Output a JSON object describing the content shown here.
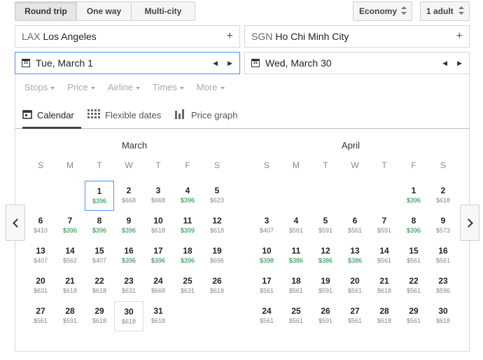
{
  "trip_type": {
    "options": [
      "Round trip",
      "One way",
      "Multi-city"
    ],
    "selected": "Round trip"
  },
  "cabin": {
    "value": "Economy"
  },
  "passengers": {
    "value": "1 adult"
  },
  "origin": {
    "code": "LAX",
    "city": "Los Angeles",
    "add": "+"
  },
  "destination": {
    "code": "SGN",
    "city": "Ho Chi Minh City",
    "add": "+"
  },
  "depart_date": {
    "value": "Tue, March 1",
    "icon_text": "31"
  },
  "return_date": {
    "value": "Wed, March 30",
    "icon_text": "31"
  },
  "filters": [
    "Stops",
    "Price",
    "Airline",
    "Times",
    "More"
  ],
  "tabs": [
    {
      "label": "Calendar",
      "icon": "calendar-icon",
      "active": true
    },
    {
      "label": "Flexible dates",
      "icon": "grid-icon",
      "active": false
    },
    {
      "label": "Price graph",
      "icon": "bar-chart-icon",
      "active": false
    }
  ],
  "weekdays": [
    "S",
    "M",
    "T",
    "W",
    "T",
    "F",
    "S"
  ],
  "colors": {
    "low_price": "#0a8f3c",
    "normal_price": "#888888",
    "selection": "#4d90fe"
  },
  "months": [
    {
      "name": "March",
      "first_weekday": 2,
      "days": [
        {
          "d": "1",
          "p": "$396",
          "low": true
        },
        {
          "d": "2",
          "p": "$668"
        },
        {
          "d": "3",
          "p": "$668"
        },
        {
          "d": "4",
          "p": "$396",
          "low": true
        },
        {
          "d": "5",
          "p": "$623"
        },
        {
          "d": "6",
          "p": "$410"
        },
        {
          "d": "7",
          "p": "$396",
          "low": true
        },
        {
          "d": "8",
          "p": "$396",
          "low": true
        },
        {
          "d": "9",
          "p": "$396",
          "low": true
        },
        {
          "d": "10",
          "p": "$618"
        },
        {
          "d": "11",
          "p": "$399",
          "low": true
        },
        {
          "d": "12",
          "p": "$618"
        },
        {
          "d": "13",
          "p": "$407"
        },
        {
          "d": "14",
          "p": "$562"
        },
        {
          "d": "15",
          "p": "$407"
        },
        {
          "d": "16",
          "p": "$396",
          "low": true
        },
        {
          "d": "17",
          "p": "$396",
          "low": true
        },
        {
          "d": "18",
          "p": "$396",
          "low": true
        },
        {
          "d": "19",
          "p": "$696"
        },
        {
          "d": "20",
          "p": "$631"
        },
        {
          "d": "21",
          "p": "$618"
        },
        {
          "d": "22",
          "p": "$618"
        },
        {
          "d": "23",
          "p": "$631"
        },
        {
          "d": "24",
          "p": "$668"
        },
        {
          "d": "25",
          "p": "$631"
        },
        {
          "d": "26",
          "p": "$618"
        },
        {
          "d": "27",
          "p": "$561"
        },
        {
          "d": "28",
          "p": "$591"
        },
        {
          "d": "29",
          "p": "$618"
        },
        {
          "d": "30",
          "p": "$618"
        },
        {
          "d": "31",
          "p": "$618"
        }
      ]
    },
    {
      "name": "April",
      "first_weekday": 5,
      "days": [
        {
          "d": "1",
          "p": "$396",
          "low": true
        },
        {
          "d": "2",
          "p": "$618"
        },
        {
          "d": "3",
          "p": "$407"
        },
        {
          "d": "4",
          "p": "$561"
        },
        {
          "d": "5",
          "p": "$591"
        },
        {
          "d": "6",
          "p": "$561"
        },
        {
          "d": "7",
          "p": "$591"
        },
        {
          "d": "8",
          "p": "$396",
          "low": true
        },
        {
          "d": "9",
          "p": "$573"
        },
        {
          "d": "10",
          "p": "$398",
          "low": true
        },
        {
          "d": "11",
          "p": "$386",
          "low": true
        },
        {
          "d": "12",
          "p": "$386",
          "low": true
        },
        {
          "d": "13",
          "p": "$386",
          "low": true
        },
        {
          "d": "14",
          "p": "$561"
        },
        {
          "d": "15",
          "p": "$561"
        },
        {
          "d": "16",
          "p": "$561"
        },
        {
          "d": "17",
          "p": "$561"
        },
        {
          "d": "18",
          "p": "$561"
        },
        {
          "d": "19",
          "p": "$591"
        },
        {
          "d": "20",
          "p": "$561"
        },
        {
          "d": "21",
          "p": "$618"
        },
        {
          "d": "22",
          "p": "$561"
        },
        {
          "d": "23",
          "p": "$596"
        },
        {
          "d": "24",
          "p": "$561"
        },
        {
          "d": "25",
          "p": "$561"
        },
        {
          "d": "26",
          "p": "$591"
        },
        {
          "d": "27",
          "p": "$561"
        },
        {
          "d": "28",
          "p": "$618"
        },
        {
          "d": "29",
          "p": "$561"
        },
        {
          "d": "30",
          "p": "$618"
        }
      ]
    }
  ],
  "selected": {
    "depart": "March 1",
    "return": "March 30"
  }
}
